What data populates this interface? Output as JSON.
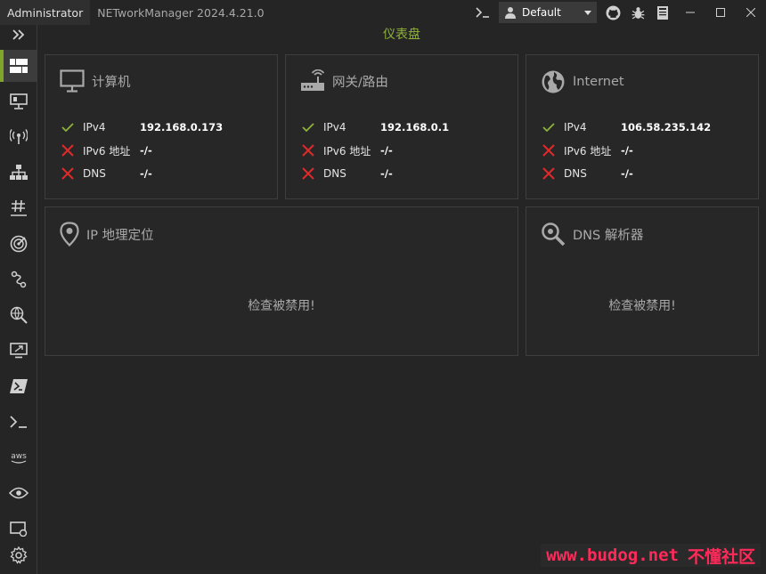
{
  "titlebar": {
    "admin": "Administrator",
    "app_title": "NETworkManager 2024.4.21.0",
    "profile": "Default"
  },
  "sidebar": {
    "active_color": "#7fa62b",
    "items": [
      {
        "icon": "chevrons-right-icon"
      },
      {
        "icon": "dashboard-icon"
      },
      {
        "icon": "network-interface-icon"
      },
      {
        "icon": "wifi-icon"
      },
      {
        "icon": "network-tree-icon"
      },
      {
        "icon": "hash-icon"
      },
      {
        "icon": "radar-icon"
      },
      {
        "icon": "route-icon"
      },
      {
        "icon": "globe-search-icon"
      },
      {
        "icon": "remote-desktop-icon"
      },
      {
        "icon": "powershell-icon"
      },
      {
        "icon": "terminal-icon"
      },
      {
        "icon": "aws-icon"
      },
      {
        "icon": "eye-icon"
      },
      {
        "icon": "screen-icon"
      },
      {
        "icon": "settings-icon"
      }
    ]
  },
  "main": {
    "title": "仪表盘",
    "computer": {
      "title": "计算机",
      "rows": [
        {
          "label": "IPv4",
          "value": "192.168.0.173",
          "ok": true
        },
        {
          "label": "IPv6 地址",
          "value": "-/-",
          "ok": false
        },
        {
          "label": "DNS",
          "value": "-/-",
          "ok": false
        }
      ]
    },
    "gateway": {
      "title": "网关/路由",
      "rows": [
        {
          "label": "IPv4",
          "value": "192.168.0.1",
          "ok": true
        },
        {
          "label": "IPv6 地址",
          "value": "-/-",
          "ok": false
        },
        {
          "label": "DNS",
          "value": "-/-",
          "ok": false
        }
      ]
    },
    "internet": {
      "title": "Internet",
      "rows": [
        {
          "label": "IPv4",
          "value": "106.58.235.142",
          "ok": true
        },
        {
          "label": "IPv6 地址",
          "value": "-/-",
          "ok": false
        },
        {
          "label": "DNS",
          "value": "-/-",
          "ok": false
        }
      ]
    },
    "ip_geolocation": {
      "title": "IP 地理定位",
      "message": "检查被禁用!"
    },
    "dns_resolver": {
      "title": "DNS 解析器",
      "message": "检查被禁用!"
    }
  },
  "watermark": {
    "url": "www.budog.net",
    "name": "不懂社区"
  },
  "colors": {
    "ok": "#8fb23a",
    "error": "#e02a2a",
    "accent": "#8fb23a"
  }
}
